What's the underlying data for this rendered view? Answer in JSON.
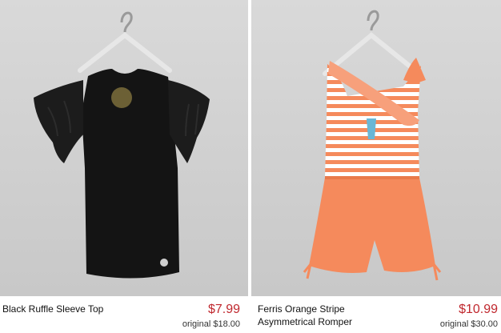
{
  "products": [
    {
      "name": "Black Ruffle Sleeve Top",
      "price": "$7.99",
      "original": "original $18.00",
      "image_icon": "black-ruffle-top-image",
      "colors": {
        "garment": "#111111",
        "accent": "#c9b06a"
      }
    },
    {
      "name_line1": "Ferris Orange Stripe",
      "name_line2": "Asymmetrical Romper",
      "price": "$10.99",
      "original": "original $30.00",
      "image_icon": "orange-romper-image",
      "colors": {
        "garment": "#f58a5c",
        "stripe": "#ffffff",
        "accent": "#69b7d6"
      }
    }
  ],
  "colors": {
    "price": "#c0282e",
    "background": "#ffffff",
    "photo_bg": "#d3d3d3"
  }
}
